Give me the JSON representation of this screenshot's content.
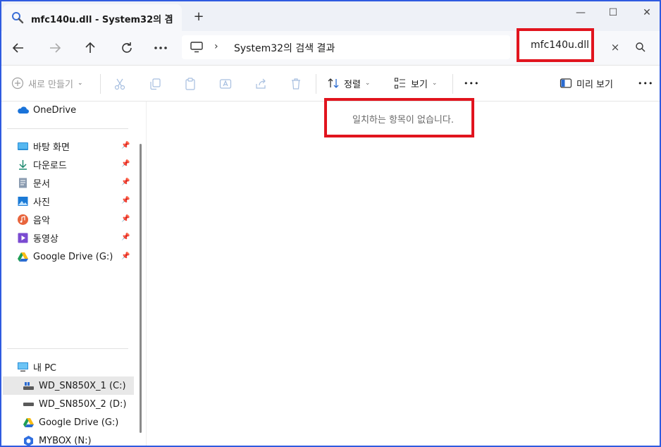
{
  "tab": {
    "title": "mfc140u.dll - System32의 검",
    "close": "×",
    "new": "+"
  },
  "window": {
    "minimize": "—",
    "maximize": "☐",
    "close": "✕"
  },
  "nav": {
    "path_chevron": "›",
    "location": "System32의 검색 결과",
    "search_value": "mfc140u.dll",
    "clear": "×"
  },
  "toolbar": {
    "new": "새로 만들기",
    "sort": "정렬",
    "view": "보기",
    "more": "•••",
    "preview": "미리 보기",
    "more2": "•••"
  },
  "sidebar": {
    "onedrive": "OneDrive",
    "quick": [
      {
        "label": "바탕 화면"
      },
      {
        "label": "다운로드"
      },
      {
        "label": "문서"
      },
      {
        "label": "사진"
      },
      {
        "label": "음악"
      },
      {
        "label": "동영상"
      },
      {
        "label": "Google Drive (G:)"
      }
    ],
    "pc": "내 PC",
    "drives": [
      {
        "label": "WD_SN850X_1 (C:)"
      },
      {
        "label": "WD_SN850X_2 (D:)"
      },
      {
        "label": "Google Drive (G:)"
      },
      {
        "label": "MYBOX (N:)"
      }
    ]
  },
  "content": {
    "empty_message": "일치하는 항목이 없습니다."
  },
  "colors": {
    "highlight": "#e1141e",
    "frame": "#2f5be0",
    "selected": "#e8e8e8"
  }
}
